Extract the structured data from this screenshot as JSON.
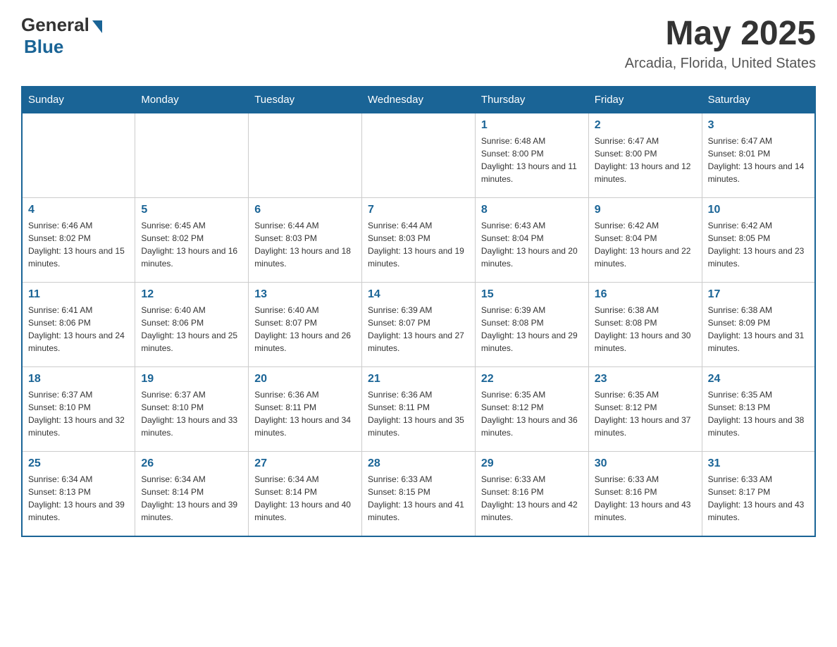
{
  "header": {
    "logo_general": "General",
    "logo_blue": "Blue",
    "month_year": "May 2025",
    "location": "Arcadia, Florida, United States"
  },
  "days_of_week": [
    "Sunday",
    "Monday",
    "Tuesday",
    "Wednesday",
    "Thursday",
    "Friday",
    "Saturday"
  ],
  "weeks": [
    [
      {
        "day": "",
        "info": ""
      },
      {
        "day": "",
        "info": ""
      },
      {
        "day": "",
        "info": ""
      },
      {
        "day": "",
        "info": ""
      },
      {
        "day": "1",
        "info": "Sunrise: 6:48 AM\nSunset: 8:00 PM\nDaylight: 13 hours and 11 minutes."
      },
      {
        "day": "2",
        "info": "Sunrise: 6:47 AM\nSunset: 8:00 PM\nDaylight: 13 hours and 12 minutes."
      },
      {
        "day": "3",
        "info": "Sunrise: 6:47 AM\nSunset: 8:01 PM\nDaylight: 13 hours and 14 minutes."
      }
    ],
    [
      {
        "day": "4",
        "info": "Sunrise: 6:46 AM\nSunset: 8:02 PM\nDaylight: 13 hours and 15 minutes."
      },
      {
        "day": "5",
        "info": "Sunrise: 6:45 AM\nSunset: 8:02 PM\nDaylight: 13 hours and 16 minutes."
      },
      {
        "day": "6",
        "info": "Sunrise: 6:44 AM\nSunset: 8:03 PM\nDaylight: 13 hours and 18 minutes."
      },
      {
        "day": "7",
        "info": "Sunrise: 6:44 AM\nSunset: 8:03 PM\nDaylight: 13 hours and 19 minutes."
      },
      {
        "day": "8",
        "info": "Sunrise: 6:43 AM\nSunset: 8:04 PM\nDaylight: 13 hours and 20 minutes."
      },
      {
        "day": "9",
        "info": "Sunrise: 6:42 AM\nSunset: 8:04 PM\nDaylight: 13 hours and 22 minutes."
      },
      {
        "day": "10",
        "info": "Sunrise: 6:42 AM\nSunset: 8:05 PM\nDaylight: 13 hours and 23 minutes."
      }
    ],
    [
      {
        "day": "11",
        "info": "Sunrise: 6:41 AM\nSunset: 8:06 PM\nDaylight: 13 hours and 24 minutes."
      },
      {
        "day": "12",
        "info": "Sunrise: 6:40 AM\nSunset: 8:06 PM\nDaylight: 13 hours and 25 minutes."
      },
      {
        "day": "13",
        "info": "Sunrise: 6:40 AM\nSunset: 8:07 PM\nDaylight: 13 hours and 26 minutes."
      },
      {
        "day": "14",
        "info": "Sunrise: 6:39 AM\nSunset: 8:07 PM\nDaylight: 13 hours and 27 minutes."
      },
      {
        "day": "15",
        "info": "Sunrise: 6:39 AM\nSunset: 8:08 PM\nDaylight: 13 hours and 29 minutes."
      },
      {
        "day": "16",
        "info": "Sunrise: 6:38 AM\nSunset: 8:08 PM\nDaylight: 13 hours and 30 minutes."
      },
      {
        "day": "17",
        "info": "Sunrise: 6:38 AM\nSunset: 8:09 PM\nDaylight: 13 hours and 31 minutes."
      }
    ],
    [
      {
        "day": "18",
        "info": "Sunrise: 6:37 AM\nSunset: 8:10 PM\nDaylight: 13 hours and 32 minutes."
      },
      {
        "day": "19",
        "info": "Sunrise: 6:37 AM\nSunset: 8:10 PM\nDaylight: 13 hours and 33 minutes."
      },
      {
        "day": "20",
        "info": "Sunrise: 6:36 AM\nSunset: 8:11 PM\nDaylight: 13 hours and 34 minutes."
      },
      {
        "day": "21",
        "info": "Sunrise: 6:36 AM\nSunset: 8:11 PM\nDaylight: 13 hours and 35 minutes."
      },
      {
        "day": "22",
        "info": "Sunrise: 6:35 AM\nSunset: 8:12 PM\nDaylight: 13 hours and 36 minutes."
      },
      {
        "day": "23",
        "info": "Sunrise: 6:35 AM\nSunset: 8:12 PM\nDaylight: 13 hours and 37 minutes."
      },
      {
        "day": "24",
        "info": "Sunrise: 6:35 AM\nSunset: 8:13 PM\nDaylight: 13 hours and 38 minutes."
      }
    ],
    [
      {
        "day": "25",
        "info": "Sunrise: 6:34 AM\nSunset: 8:13 PM\nDaylight: 13 hours and 39 minutes."
      },
      {
        "day": "26",
        "info": "Sunrise: 6:34 AM\nSunset: 8:14 PM\nDaylight: 13 hours and 39 minutes."
      },
      {
        "day": "27",
        "info": "Sunrise: 6:34 AM\nSunset: 8:14 PM\nDaylight: 13 hours and 40 minutes."
      },
      {
        "day": "28",
        "info": "Sunrise: 6:33 AM\nSunset: 8:15 PM\nDaylight: 13 hours and 41 minutes."
      },
      {
        "day": "29",
        "info": "Sunrise: 6:33 AM\nSunset: 8:16 PM\nDaylight: 13 hours and 42 minutes."
      },
      {
        "day": "30",
        "info": "Sunrise: 6:33 AM\nSunset: 8:16 PM\nDaylight: 13 hours and 43 minutes."
      },
      {
        "day": "31",
        "info": "Sunrise: 6:33 AM\nSunset: 8:17 PM\nDaylight: 13 hours and 43 minutes."
      }
    ]
  ]
}
